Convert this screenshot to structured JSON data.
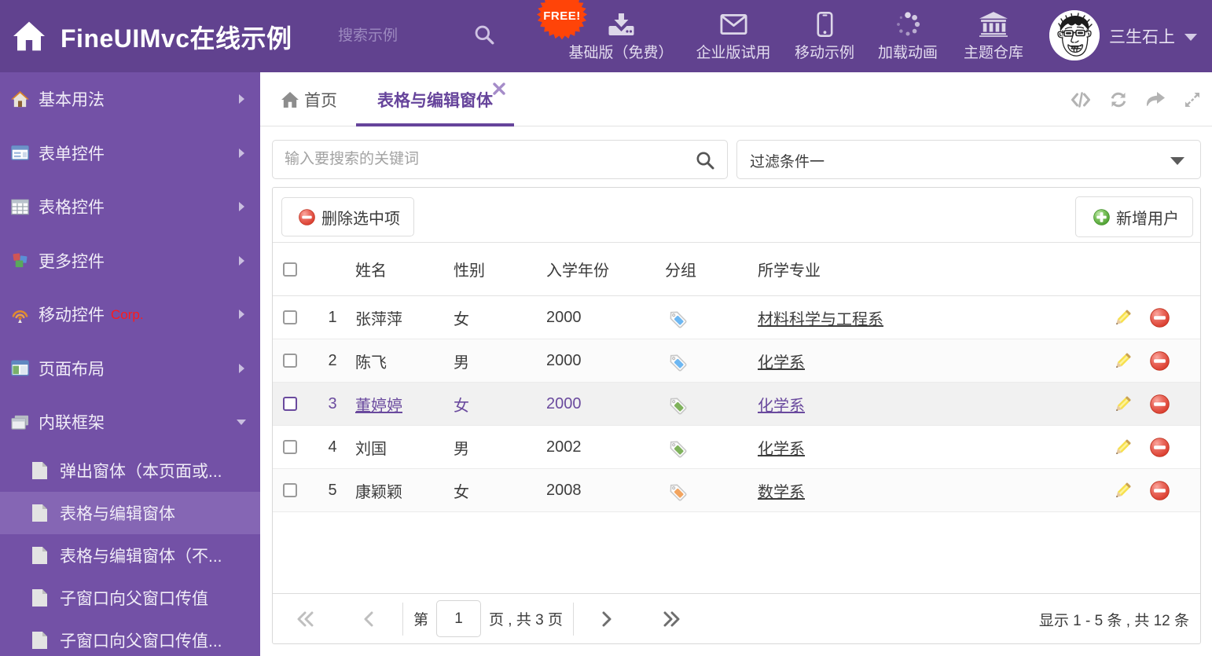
{
  "header": {
    "title": "FineUIMvc在线示例",
    "search_placeholder": "搜索示例",
    "free_badge": "FREE!",
    "free_badge_color": "#ff4408",
    "nav_items": [
      {
        "label": "基础版（免费）",
        "icon": "download-icon"
      },
      {
        "label": "企业版试用",
        "icon": "envelope-icon"
      },
      {
        "label": "移动示例",
        "icon": "mobile-icon"
      },
      {
        "label": "加载动画",
        "icon": "spinner-icon"
      },
      {
        "label": "主题仓库",
        "icon": "bank-icon"
      }
    ],
    "username": "三生石上",
    "bg_color": "#61428f"
  },
  "sidebar": {
    "bg_color": "#7351a6",
    "selected_bg_color": "#8566b4",
    "items": [
      {
        "label": "基本用法",
        "icon": "home-icon"
      },
      {
        "label": "表单控件",
        "icon": "form-icon"
      },
      {
        "label": "表格控件",
        "icon": "table-icon"
      },
      {
        "label": "更多控件",
        "icon": "cubes-icon"
      },
      {
        "label": "移动控件",
        "icon": "signal-icon",
        "badge": "Corp."
      },
      {
        "label": "页面布局",
        "icon": "layout-icon"
      },
      {
        "label": "内联框架",
        "icon": "frames-icon",
        "expanded": true
      }
    ],
    "subitems": [
      {
        "label": "弹出窗体（本页面或...",
        "selected": false
      },
      {
        "label": "表格与编辑窗体",
        "selected": true
      },
      {
        "label": "表格与编辑窗体（不...",
        "selected": false
      },
      {
        "label": "子窗口向父窗口传值",
        "selected": false
      },
      {
        "label": "子窗口向父窗口传值...",
        "selected": false
      }
    ]
  },
  "tabs": {
    "home_label": "首页",
    "active_label": "表格与编辑窗体",
    "active_color": "#66449b",
    "tools": [
      "code-icon",
      "refresh-icon",
      "share-icon",
      "expand-icon"
    ]
  },
  "filters": {
    "search_placeholder": "输入要搜索的关键词",
    "dropdown_value": "过滤条件一"
  },
  "toolbar": {
    "delete_label": "删除选中项",
    "add_label": "新增用户"
  },
  "table": {
    "columns": [
      "姓名",
      "性别",
      "入学年份",
      "分组",
      "所学专业"
    ],
    "rows": [
      {
        "num": "1",
        "name": "张萍萍",
        "gender": "女",
        "year": "2000",
        "tag_color": "#6db7f2",
        "major": "材料科学与工程系",
        "selected": false
      },
      {
        "num": "2",
        "name": "陈飞",
        "gender": "男",
        "year": "2000",
        "tag_color": "#6db7f2",
        "major": "化学系",
        "selected": false
      },
      {
        "num": "3",
        "name": "董婷婷",
        "gender": "女",
        "year": "2000",
        "tag_color": "#7fb25c",
        "major": "化学系",
        "selected": true
      },
      {
        "num": "4",
        "name": "刘国",
        "gender": "男",
        "year": "2002",
        "tag_color": "#7fb25c",
        "major": "化学系",
        "selected": false
      },
      {
        "num": "5",
        "name": "康颖颖",
        "gender": "女",
        "year": "2008",
        "tag_color": "#f2a45f",
        "major": "数学系",
        "selected": false
      }
    ],
    "selected_row_color": "#6a4a9e"
  },
  "pagination": {
    "page_prefix": "第",
    "page_value": "1",
    "page_suffix": "页 , 共 3 页",
    "summary": "显示 1 - 5 条 , 共 12 条"
  }
}
